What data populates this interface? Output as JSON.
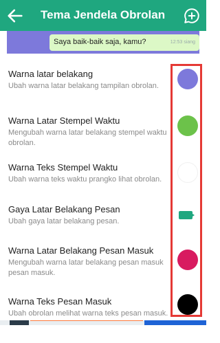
{
  "app": {
    "title": "Tema Jendela Obrolan",
    "accent": "#1fa77f",
    "header_icons": [
      "back-arrow-icon",
      "add-chat-bubble-icon"
    ]
  },
  "preview": {
    "message": "Saya baik-baik saja, kamu?",
    "time": "12:53 siang",
    "background_color": "#7d79db",
    "bubble_color": "#dcf8c6"
  },
  "settings": [
    {
      "title": "Warna latar belakang",
      "subtitle": "Ubah warna latar belakang tampilan obrolan.",
      "color": "#7d79db"
    },
    {
      "title": "Warna Latar Stempel Waktu",
      "subtitle": "Mengubah warna latar belakang stempel waktu obrolan.",
      "color": "#6cc24a"
    },
    {
      "title": "Warna Teks Stempel Waktu",
      "subtitle": "Ubah warna teks waktu prangko lihat obrolan.",
      "color": "#ffffff"
    },
    {
      "title": "Gaya Latar Belakang Pesan",
      "subtitle": "Ubah gaya latar belakang pesan.",
      "color": "#1fa77f",
      "icon": "message-bubble-icon"
    },
    {
      "title": "Warna Latar Belakang Pesan Masuk",
      "subtitle": "Mengubah warna latar belakang pesan masuk pesan masuk.",
      "color": "#d81b60"
    },
    {
      "title": "Warna Teks Pesan Masuk",
      "subtitle": "Ubah obrolan melihat warna teks pesan masuk.",
      "color": "#000000"
    }
  ],
  "highlight_color": "#e53935"
}
